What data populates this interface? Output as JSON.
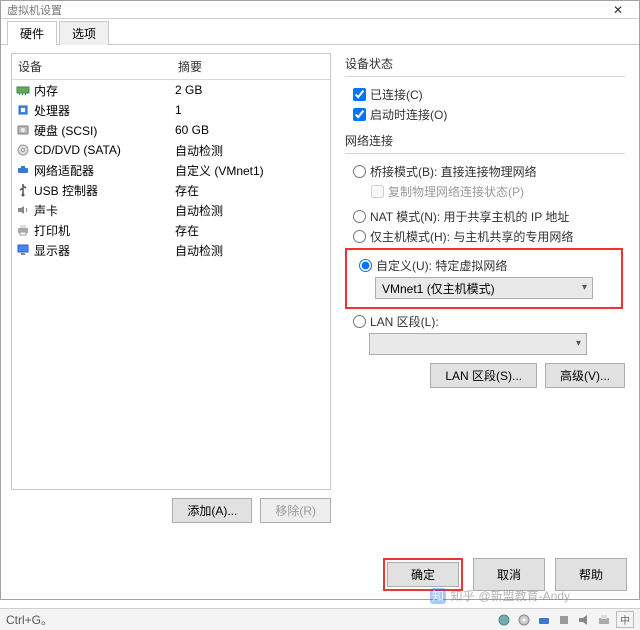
{
  "window": {
    "title": "虚拟机设置",
    "close": "✕"
  },
  "tabs": {
    "hardware": "硬件",
    "options": "选项"
  },
  "columns": {
    "device": "设备",
    "summary": "摘要"
  },
  "devices": [
    {
      "icon": "memory",
      "name": "内存",
      "summary": "2 GB"
    },
    {
      "icon": "cpu",
      "name": "处理器",
      "summary": "1"
    },
    {
      "icon": "disk",
      "name": "硬盘 (SCSI)",
      "summary": "60 GB"
    },
    {
      "icon": "cd",
      "name": "CD/DVD (SATA)",
      "summary": "自动检测"
    },
    {
      "icon": "net",
      "name": "网络适配器",
      "summary": "自定义 (VMnet1)"
    },
    {
      "icon": "usb",
      "name": "USB 控制器",
      "summary": "存在"
    },
    {
      "icon": "sound",
      "name": "声卡",
      "summary": "自动检测"
    },
    {
      "icon": "printer",
      "name": "打印机",
      "summary": "存在"
    },
    {
      "icon": "display",
      "name": "显示器",
      "summary": "自动检测"
    }
  ],
  "left_buttons": {
    "add": "添加(A)...",
    "remove": "移除(R)"
  },
  "status": {
    "legend": "设备状态",
    "connected": "已连接(C)",
    "connect_on": "启动时连接(O)"
  },
  "net": {
    "legend": "网络连接",
    "bridged": "桥接模式(B): 直接连接物理网络",
    "replicate": "复制物理网络连接状态(P)",
    "nat": "NAT 模式(N): 用于共享主机的 IP 地址",
    "hostonly": "仅主机模式(H): 与主机共享的专用网络",
    "custom": "自定义(U): 特定虚拟网络",
    "custom_value": "VMnet1 (仅主机模式)",
    "lan": "LAN 区段(L):",
    "lan_value": "",
    "btn_lanseg": "LAN 区段(S)...",
    "btn_adv": "高级(V)..."
  },
  "footer": {
    "ok": "确定",
    "cancel": "取消",
    "help": "帮助"
  },
  "statusbar": {
    "text": "Ctrl+G。"
  },
  "watermark": {
    "brand": "知乎",
    "author": "@新盟教育-Andy"
  }
}
